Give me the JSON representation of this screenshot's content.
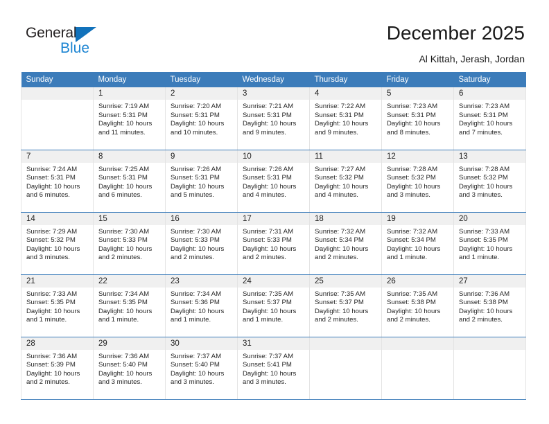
{
  "brand": {
    "name_top": "General",
    "name_bottom": "Blue",
    "accent_color": "#1272bb",
    "blue_text_color": "#1b84d2"
  },
  "header": {
    "title": "December 2025",
    "subtitle": "Al Kittah, Jerash, Jordan"
  },
  "calendar": {
    "header_bg": "#3c7cba",
    "daynum_bg": "#f0f0f0",
    "weekday_headers": [
      "Sunday",
      "Monday",
      "Tuesday",
      "Wednesday",
      "Thursday",
      "Friday",
      "Saturday"
    ],
    "weeks": [
      [
        {
          "day": "",
          "lines": []
        },
        {
          "day": "1",
          "lines": [
            "Sunrise: 7:19 AM",
            "Sunset: 5:31 PM",
            "Daylight: 10 hours",
            "and 11 minutes."
          ]
        },
        {
          "day": "2",
          "lines": [
            "Sunrise: 7:20 AM",
            "Sunset: 5:31 PM",
            "Daylight: 10 hours",
            "and 10 minutes."
          ]
        },
        {
          "day": "3",
          "lines": [
            "Sunrise: 7:21 AM",
            "Sunset: 5:31 PM",
            "Daylight: 10 hours",
            "and 9 minutes."
          ]
        },
        {
          "day": "4",
          "lines": [
            "Sunrise: 7:22 AM",
            "Sunset: 5:31 PM",
            "Daylight: 10 hours",
            "and 9 minutes."
          ]
        },
        {
          "day": "5",
          "lines": [
            "Sunrise: 7:23 AM",
            "Sunset: 5:31 PM",
            "Daylight: 10 hours",
            "and 8 minutes."
          ]
        },
        {
          "day": "6",
          "lines": [
            "Sunrise: 7:23 AM",
            "Sunset: 5:31 PM",
            "Daylight: 10 hours",
            "and 7 minutes."
          ]
        }
      ],
      [
        {
          "day": "7",
          "lines": [
            "Sunrise: 7:24 AM",
            "Sunset: 5:31 PM",
            "Daylight: 10 hours",
            "and 6 minutes."
          ]
        },
        {
          "day": "8",
          "lines": [
            "Sunrise: 7:25 AM",
            "Sunset: 5:31 PM",
            "Daylight: 10 hours",
            "and 6 minutes."
          ]
        },
        {
          "day": "9",
          "lines": [
            "Sunrise: 7:26 AM",
            "Sunset: 5:31 PM",
            "Daylight: 10 hours",
            "and 5 minutes."
          ]
        },
        {
          "day": "10",
          "lines": [
            "Sunrise: 7:26 AM",
            "Sunset: 5:31 PM",
            "Daylight: 10 hours",
            "and 4 minutes."
          ]
        },
        {
          "day": "11",
          "lines": [
            "Sunrise: 7:27 AM",
            "Sunset: 5:32 PM",
            "Daylight: 10 hours",
            "and 4 minutes."
          ]
        },
        {
          "day": "12",
          "lines": [
            "Sunrise: 7:28 AM",
            "Sunset: 5:32 PM",
            "Daylight: 10 hours",
            "and 3 minutes."
          ]
        },
        {
          "day": "13",
          "lines": [
            "Sunrise: 7:28 AM",
            "Sunset: 5:32 PM",
            "Daylight: 10 hours",
            "and 3 minutes."
          ]
        }
      ],
      [
        {
          "day": "14",
          "lines": [
            "Sunrise: 7:29 AM",
            "Sunset: 5:32 PM",
            "Daylight: 10 hours",
            "and 3 minutes."
          ]
        },
        {
          "day": "15",
          "lines": [
            "Sunrise: 7:30 AM",
            "Sunset: 5:33 PM",
            "Daylight: 10 hours",
            "and 2 minutes."
          ]
        },
        {
          "day": "16",
          "lines": [
            "Sunrise: 7:30 AM",
            "Sunset: 5:33 PM",
            "Daylight: 10 hours",
            "and 2 minutes."
          ]
        },
        {
          "day": "17",
          "lines": [
            "Sunrise: 7:31 AM",
            "Sunset: 5:33 PM",
            "Daylight: 10 hours",
            "and 2 minutes."
          ]
        },
        {
          "day": "18",
          "lines": [
            "Sunrise: 7:32 AM",
            "Sunset: 5:34 PM",
            "Daylight: 10 hours",
            "and 2 minutes."
          ]
        },
        {
          "day": "19",
          "lines": [
            "Sunrise: 7:32 AM",
            "Sunset: 5:34 PM",
            "Daylight: 10 hours",
            "and 1 minute."
          ]
        },
        {
          "day": "20",
          "lines": [
            "Sunrise: 7:33 AM",
            "Sunset: 5:35 PM",
            "Daylight: 10 hours",
            "and 1 minute."
          ]
        }
      ],
      [
        {
          "day": "21",
          "lines": [
            "Sunrise: 7:33 AM",
            "Sunset: 5:35 PM",
            "Daylight: 10 hours",
            "and 1 minute."
          ]
        },
        {
          "day": "22",
          "lines": [
            "Sunrise: 7:34 AM",
            "Sunset: 5:35 PM",
            "Daylight: 10 hours",
            "and 1 minute."
          ]
        },
        {
          "day": "23",
          "lines": [
            "Sunrise: 7:34 AM",
            "Sunset: 5:36 PM",
            "Daylight: 10 hours",
            "and 1 minute."
          ]
        },
        {
          "day": "24",
          "lines": [
            "Sunrise: 7:35 AM",
            "Sunset: 5:37 PM",
            "Daylight: 10 hours",
            "and 1 minute."
          ]
        },
        {
          "day": "25",
          "lines": [
            "Sunrise: 7:35 AM",
            "Sunset: 5:37 PM",
            "Daylight: 10 hours",
            "and 2 minutes."
          ]
        },
        {
          "day": "26",
          "lines": [
            "Sunrise: 7:35 AM",
            "Sunset: 5:38 PM",
            "Daylight: 10 hours",
            "and 2 minutes."
          ]
        },
        {
          "day": "27",
          "lines": [
            "Sunrise: 7:36 AM",
            "Sunset: 5:38 PM",
            "Daylight: 10 hours",
            "and 2 minutes."
          ]
        }
      ],
      [
        {
          "day": "28",
          "lines": [
            "Sunrise: 7:36 AM",
            "Sunset: 5:39 PM",
            "Daylight: 10 hours",
            "and 2 minutes."
          ]
        },
        {
          "day": "29",
          "lines": [
            "Sunrise: 7:36 AM",
            "Sunset: 5:40 PM",
            "Daylight: 10 hours",
            "and 3 minutes."
          ]
        },
        {
          "day": "30",
          "lines": [
            "Sunrise: 7:37 AM",
            "Sunset: 5:40 PM",
            "Daylight: 10 hours",
            "and 3 minutes."
          ]
        },
        {
          "day": "31",
          "lines": [
            "Sunrise: 7:37 AM",
            "Sunset: 5:41 PM",
            "Daylight: 10 hours",
            "and 3 minutes."
          ]
        },
        {
          "day": "",
          "lines": []
        },
        {
          "day": "",
          "lines": []
        },
        {
          "day": "",
          "lines": []
        }
      ]
    ]
  }
}
